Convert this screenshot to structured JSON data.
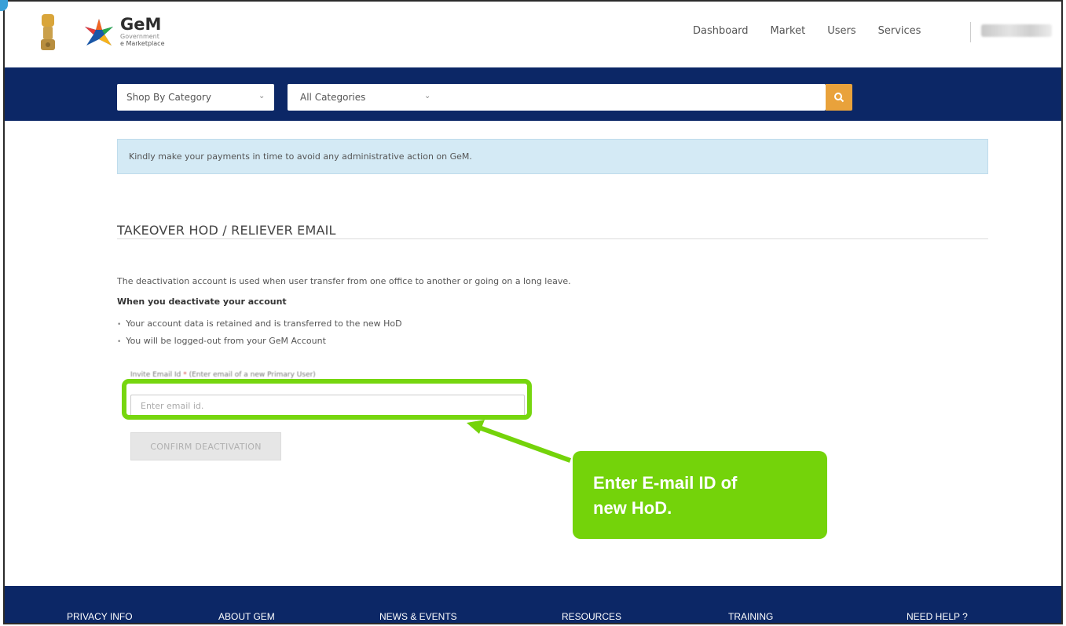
{
  "header": {
    "brand_name": "GeM",
    "brand_sub": "Government",
    "brand_sub2": "e Marketplace",
    "nav": [
      "Dashboard",
      "Market",
      "Users",
      "Services"
    ]
  },
  "search": {
    "shop_by_category": "Shop By Category",
    "all_categories": "All Categories",
    "search_icon": "magnifier-icon"
  },
  "alert": {
    "text": "Kindly make your payments in time to avoid any administrative action on GeM."
  },
  "page": {
    "title": "TAKEOVER HOD / RELIEVER EMAIL",
    "description": "The deactivation account is used when user transfer from one office to another or going on a long leave.",
    "sub_heading": "When you deactivate your account",
    "bullets": [
      "Your account data is retained and is transferred to the new HoD",
      "You will be logged-out from your GeM Account"
    ],
    "email_label": "Invite Email Id",
    "email_required_mark": "*",
    "email_hint": "(Enter email of a new Primary User)",
    "email_placeholder": "Enter email id.",
    "confirm_button": "CONFIRM DEACTIVATION"
  },
  "callout": {
    "line1": "Enter E-mail ID  of",
    "line2": "new HoD."
  },
  "footer": {
    "links": [
      "PRIVACY INFO",
      "ABOUT GEM",
      "NEWS & EVENTS",
      "RESOURCES",
      "TRAINING",
      "NEED HELP ?"
    ]
  },
  "colors": {
    "navy": "#0c2766",
    "search_orange": "#e9a23b",
    "highlight_green": "#76d60f",
    "alert_blue": "#d4eaf5"
  }
}
